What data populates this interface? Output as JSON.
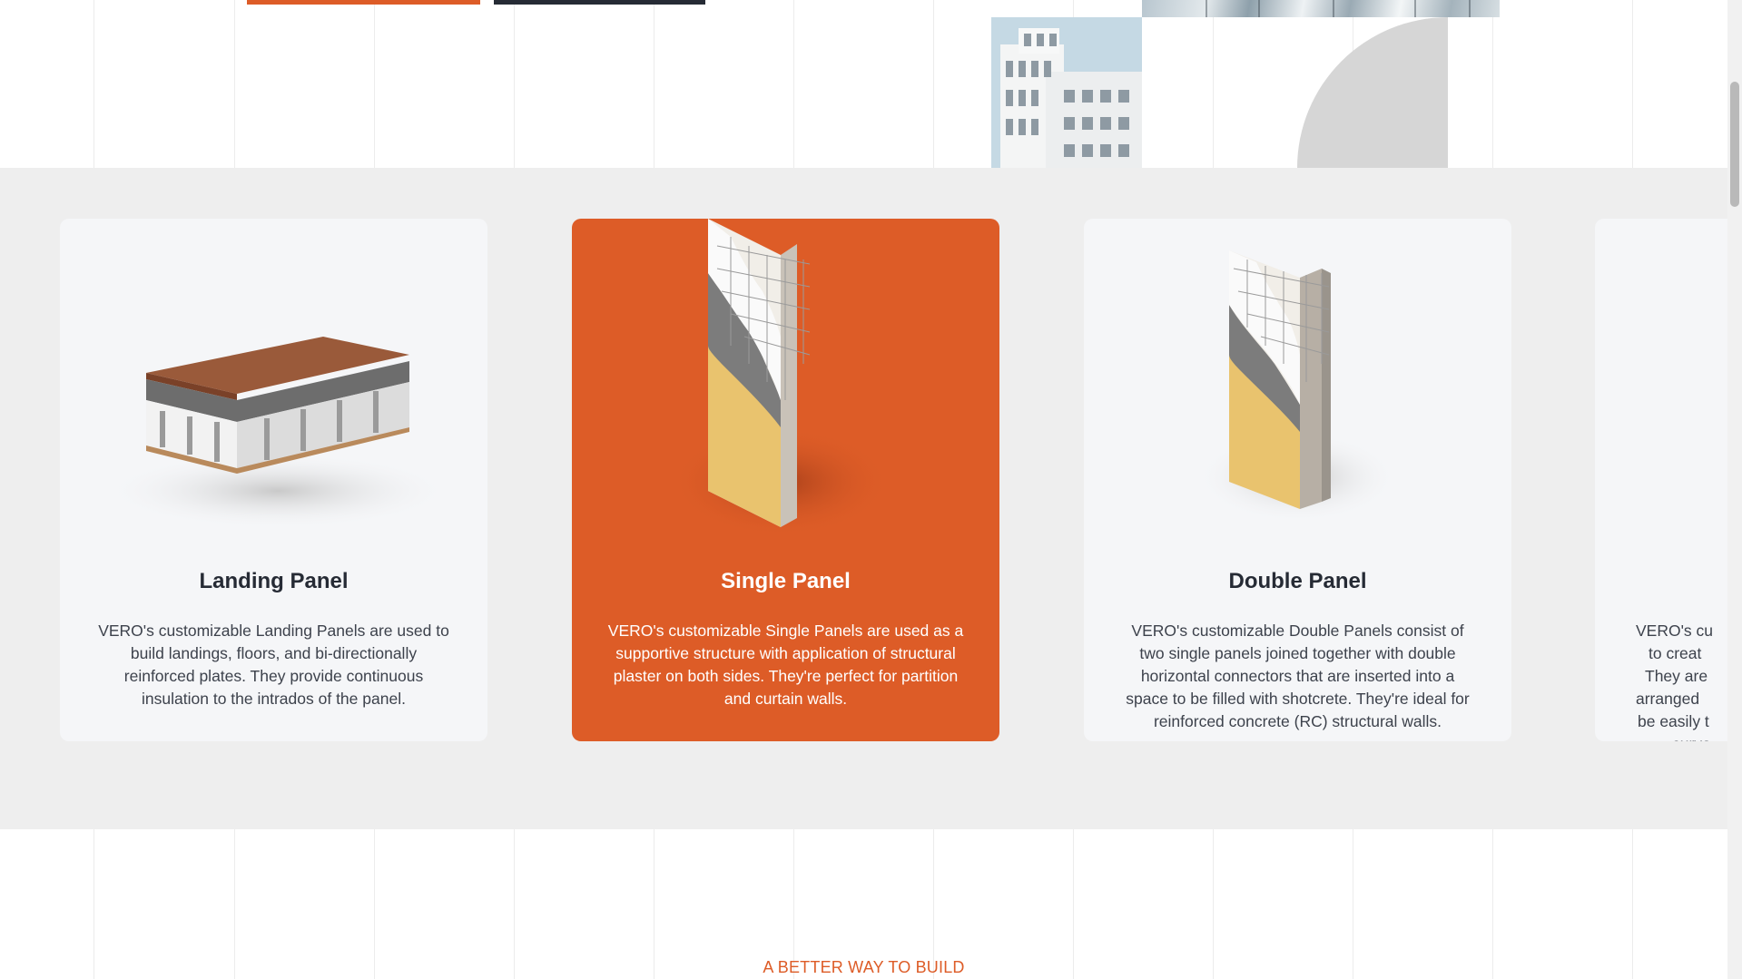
{
  "colors": {
    "accent": "#dd5c27",
    "dark": "#262b35",
    "section_bg": "#eeeeee",
    "card_bg": "#f5f6f8"
  },
  "hero": {
    "primary_button_color": "#dd5c27",
    "secondary_button_color": "#262b35"
  },
  "panels": [
    {
      "title": "Landing Panel",
      "description": "VERO's customizable Landing Panels are used to build landings, floors, and bi-directionally reinforced plates. They provide continuous insulation to the intrados of the panel.",
      "image_icon": "landing-panel-illustration",
      "active": false
    },
    {
      "title": "Single Panel",
      "description": "VERO's customizable Single Panels are used as a supportive structure with application of structural plaster on both sides. They're perfect for partition and curtain walls.",
      "image_icon": "single-panel-illustration",
      "active": true
    },
    {
      "title": "Double Panel",
      "description": "VERO's customizable Double Panels consist of two single panels joined together with double horizontal connectors that are inserted into a space to be filled with shotcrete. They're ideal for reinforced concrete (RC) structural walls.",
      "image_icon": "double-panel-illustration",
      "active": false
    }
  ],
  "partial_panel": {
    "description_lines": [
      "VERO's cu",
      "to creat",
      "They are",
      "arranged",
      "be easily t",
      "curve"
    ]
  },
  "next_section": {
    "label": "A BETTER WAY TO BUILD"
  }
}
